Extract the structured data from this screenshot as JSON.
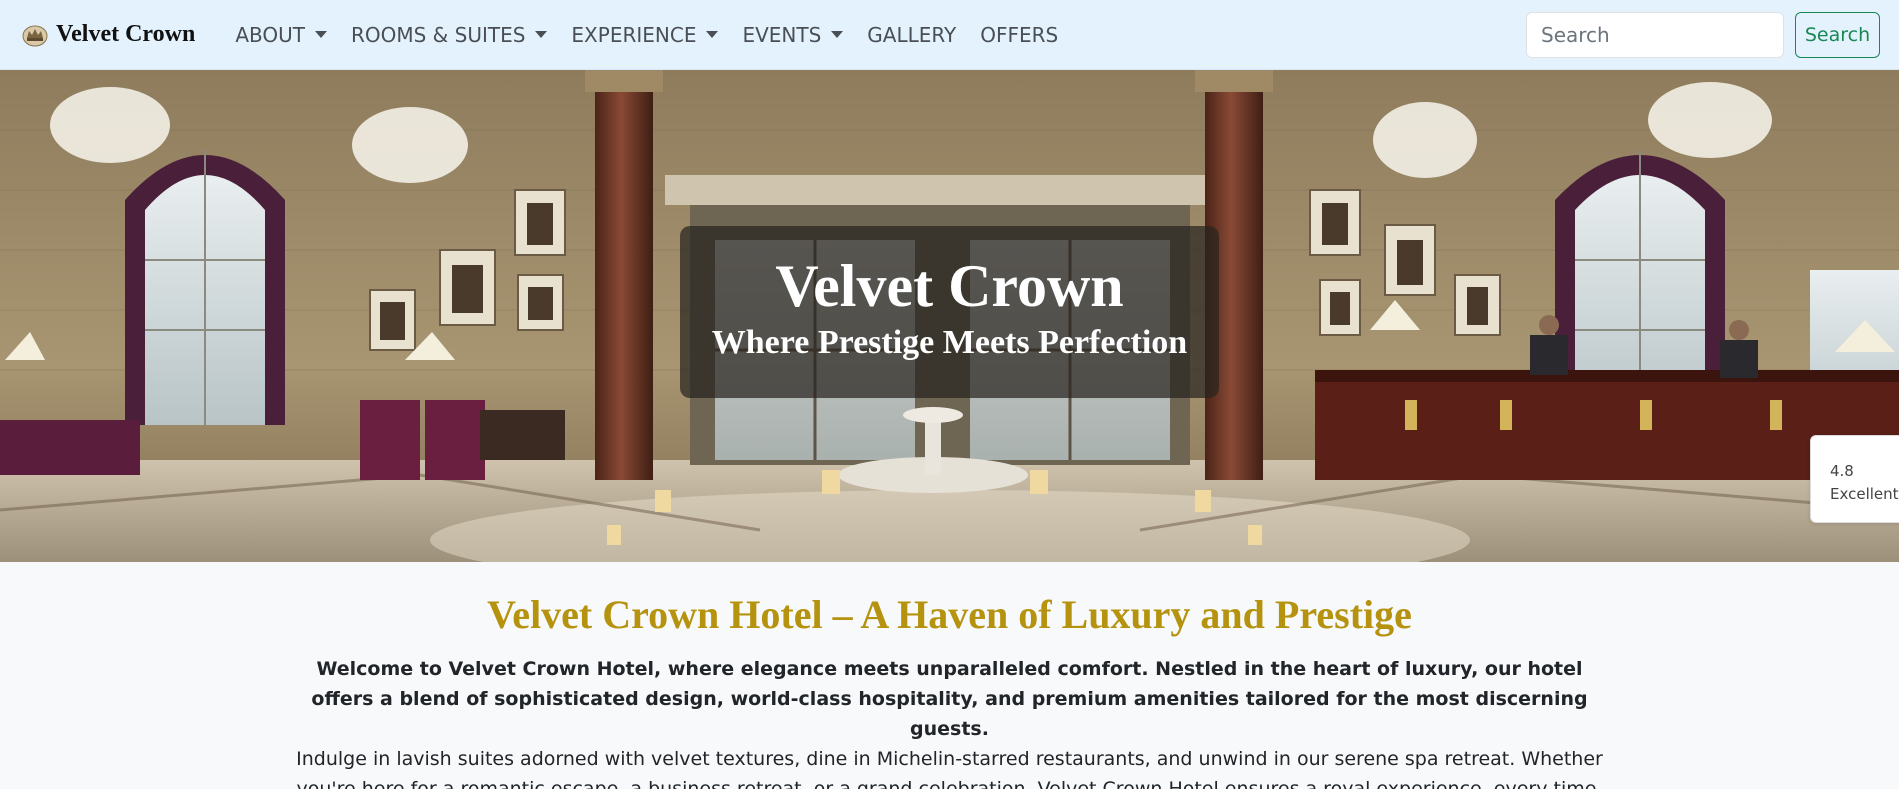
{
  "navbar": {
    "brand_name": "Velvet Crown",
    "items": [
      {
        "label": "ABOUT",
        "dropdown": true
      },
      {
        "label": "ROOMS & SUITES",
        "dropdown": true
      },
      {
        "label": "EXPERIENCE",
        "dropdown": true
      },
      {
        "label": "EVENTS",
        "dropdown": true
      },
      {
        "label": "GALLERY",
        "dropdown": false
      },
      {
        "label": "OFFERS",
        "dropdown": false
      }
    ],
    "search": {
      "placeholder": "Search",
      "button_label": "Search"
    },
    "colors": {
      "background": "#e3f2fd",
      "search_button": "#198754"
    }
  },
  "hero": {
    "title": "Velvet Crown",
    "subtitle": "Where Prestige Meets Perfection"
  },
  "rating_widget": {
    "score": "4.8",
    "label": "Excellent"
  },
  "intro": {
    "heading": "Velvet Crown Hotel – A Haven of Luxury and Prestige",
    "lead": "Welcome to Velvet Crown Hotel, where elegance meets unparalleled comfort. Nestled in the heart of luxury, our hotel offers a blend of sophisticated design, world-class hospitality, and premium amenities tailored for the most discerning guests.",
    "body": "Indulge in lavish suites adorned with velvet textures, dine in Michelin-starred restaurants, and unwind in our serene spa retreat. Whether you're here for a romantic escape, a business retreat, or a grand celebration, Velvet Crown Hotel ensures a royal experience, every time.",
    "heading_color": "#b5930f"
  },
  "icons": [
    "crown-logo-icon",
    "chevron-down-icon"
  ]
}
